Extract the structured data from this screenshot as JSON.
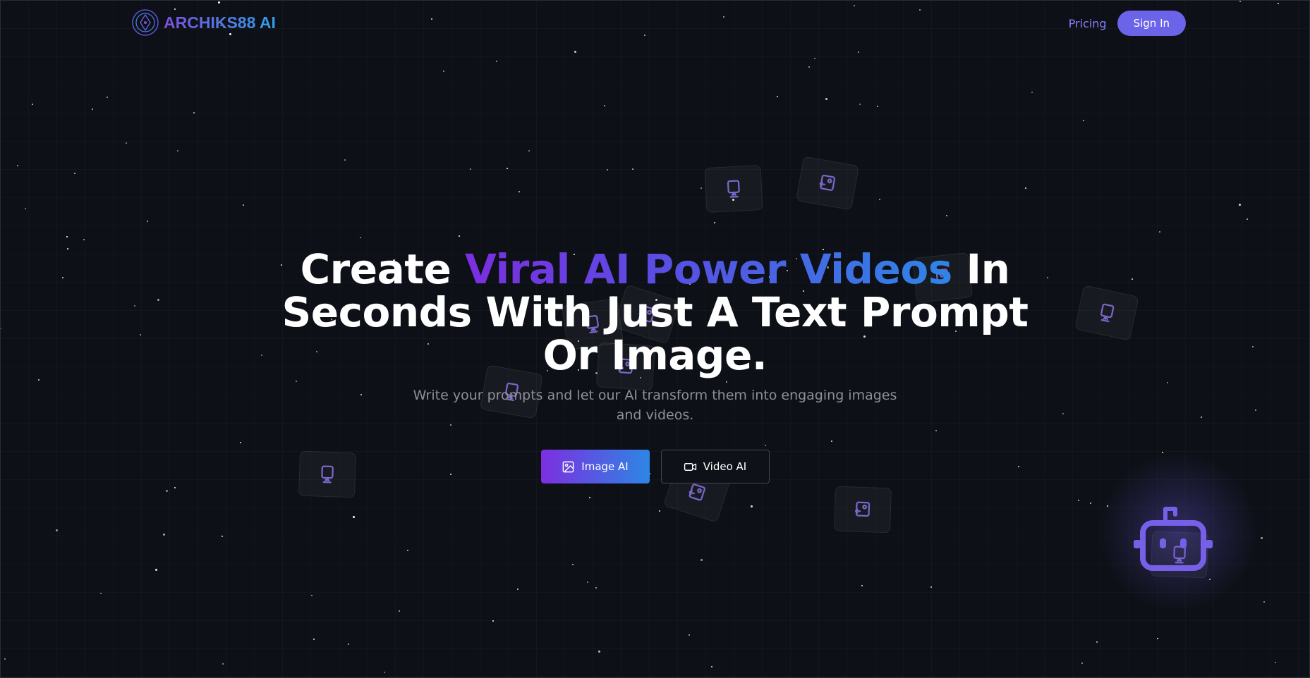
{
  "brand": {
    "name": "ARCHIKS88 AI",
    "icon": "compass-logo-icon"
  },
  "nav": {
    "pricing": "Pricing",
    "signin": "Sign In"
  },
  "hero": {
    "headline_pre": "Create ",
    "headline_grad": "Viral AI Power Videos",
    "headline_post": " In Seconds With Just A Text Prompt Or Image.",
    "subtitle": "Write your prompts and let our AI transform them into engaging images and videos."
  },
  "cta": {
    "image": {
      "label": "Image AI",
      "icon": "image-icon"
    },
    "video": {
      "label": "Video AI",
      "icon": "video-camera-icon"
    }
  },
  "floating_icons": [
    "monitor-icon",
    "image-swap-icon"
  ],
  "assistant": {
    "icon": "robot-assistant-icon"
  },
  "colors": {
    "background": "#0d1016",
    "accent": "#6b63e8",
    "gradient_start": "#7b2ee0",
    "gradient_end": "#2e86e6",
    "muted_text": "#8e9096"
  }
}
